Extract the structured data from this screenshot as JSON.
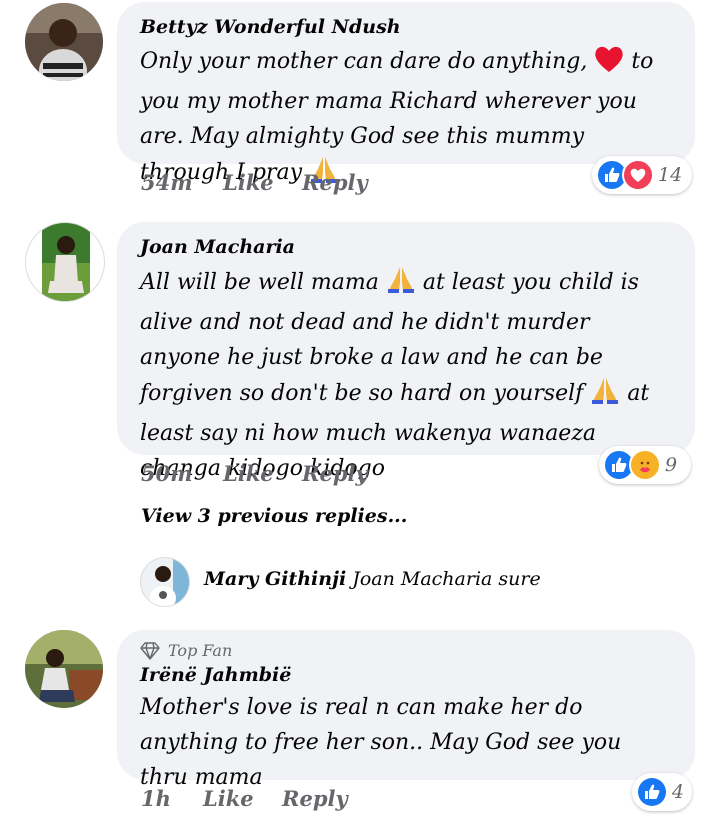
{
  "comments": [
    {
      "author": "Bettyz Wonderful Ndush",
      "text_before": "Only your mother can dare do anything,",
      "text_after": "to you my mother mama Richard wherever you are. May almighty God see this mummy through I pray",
      "emoji_inline": [
        "red-heart-icon",
        "praying-hands-icon"
      ],
      "time": "54m",
      "like_label": "Like",
      "reply_label": "Reply",
      "reactions": [
        "like-reaction-icon",
        "love-reaction-icon"
      ],
      "reaction_count": "14"
    },
    {
      "author": "Joan Macharia",
      "text_part1": "All will be well mama",
      "text_part2": "at least you child is alive and not dead and he didn't murder anyone he just broke a law and he can be forgiven so don't be so hard on yourself",
      "text_part3": "at least say ni how much wakenya wanaeza changa kidogo kidogo",
      "time": "50m",
      "like_label": "Like",
      "reply_label": "Reply",
      "reactions": [
        "like-reaction-icon",
        "care-reaction-icon"
      ],
      "reaction_count": "9"
    },
    {
      "badge": "Top Fan",
      "author": "Irënë Jahmbië",
      "text": "Mother's love is real n can make her do anything to free her son.. May God see you thru mama",
      "time": "1h",
      "like_label": "Like",
      "reply_label": "Reply",
      "reactions": [
        "like-reaction-icon"
      ],
      "reaction_count": "4"
    }
  ],
  "view_replies": "View 3 previous replies...",
  "reply": {
    "author": "Mary Githinji",
    "mention": "Joan Macharia",
    "text": "sure"
  },
  "colors": {
    "bubble": "#f0f2f5",
    "muted": "#65676b",
    "like_blue": "#1877f2",
    "love_red": "#f33e58"
  }
}
